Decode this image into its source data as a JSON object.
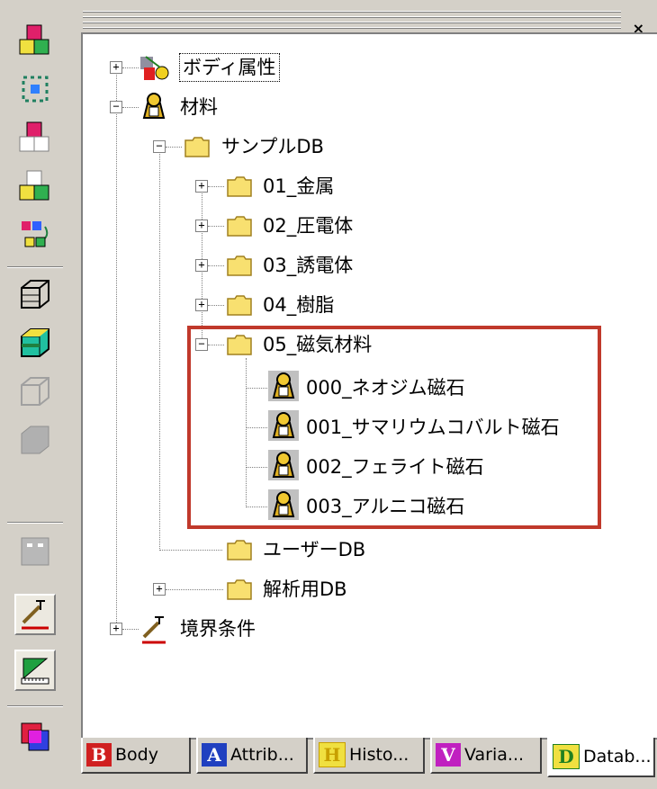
{
  "tree": {
    "body_attr": "ボディ属性",
    "material": "材料",
    "sample_db": "サンプルDB",
    "folders": [
      "01_金属",
      "02_圧電体",
      "03_誘電体",
      "04_樹脂",
      "05_磁気材料"
    ],
    "magnets": [
      "000_ネオジム磁石",
      "001_サマリウムコバルト磁石",
      "002_フェライト磁石",
      "003_アルニコ磁石"
    ],
    "user_db": "ユーザーDB",
    "analysis_db": "解析用DB",
    "boundary": "境界条件"
  },
  "tabs": [
    {
      "icon_letter": "B",
      "label": "Body",
      "icon_color": "#d02020"
    },
    {
      "icon_letter": "A",
      "label": "Attrib...",
      "icon_color": "#2040c0"
    },
    {
      "icon_letter": "H",
      "label": "Histo...",
      "icon_color": "#c8a000"
    },
    {
      "icon_letter": "V",
      "label": "Varia...",
      "icon_color": "#a020c0"
    },
    {
      "icon_letter": "D",
      "label": "Datab...",
      "icon_color": "#20a020"
    }
  ],
  "close_glyph": "×",
  "highlight_color": "#c0392b"
}
